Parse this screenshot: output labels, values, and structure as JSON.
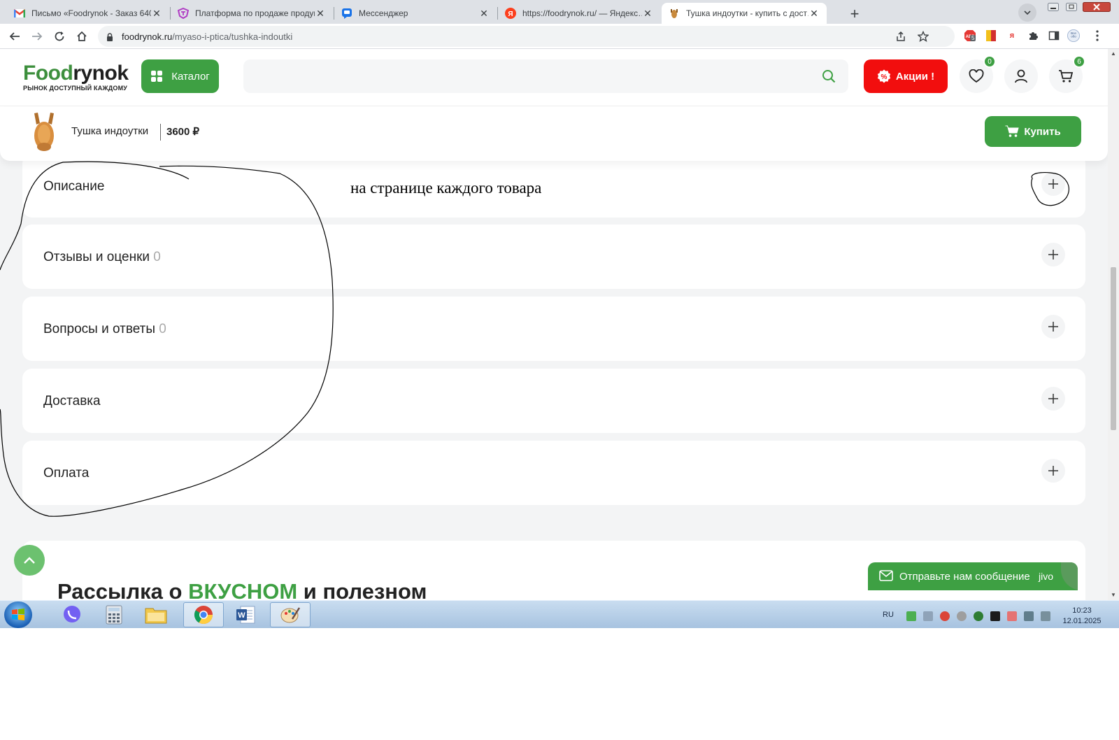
{
  "browser": {
    "tabs": [
      {
        "title": "Письмо «Foodrynok - Заказ 640…",
        "icon": "gmail-icon"
      },
      {
        "title": "Платформа по продаже продук…",
        "icon": "platform-icon"
      },
      {
        "title": "Мессенджер",
        "icon": "messenger-icon"
      },
      {
        "title": "https://foodrynok.ru/ — Яндекс…",
        "icon": "yandex-icon"
      },
      {
        "title": "Тушка индоутки - купить с дост…",
        "icon": "duck-icon"
      }
    ],
    "address": {
      "domain": "foodrynok.ru",
      "path": "/myaso-i-ptica/tushka-indoutki"
    },
    "extension_badge": "5"
  },
  "site": {
    "logo": {
      "part1": "Food",
      "part2": "rynok",
      "tagline": "РЫНОК ДОСТУПНЫЙ КАЖДОМУ"
    },
    "catalog_label": "Каталог",
    "promo_label": "Акции !",
    "favorites_count": "0",
    "cart_count": "6"
  },
  "product": {
    "name": "Тушка индоутки",
    "price": "3600 ₽",
    "buy_label": "Купить"
  },
  "sections": [
    {
      "title": "Описание",
      "count": ""
    },
    {
      "title": "Отзывы и оценки",
      "count": "0"
    },
    {
      "title": "Вопросы и ответы",
      "count": "0"
    },
    {
      "title": "Доставка",
      "count": ""
    },
    {
      "title": "Оплата",
      "count": ""
    }
  ],
  "annotation_text": "на странице каждого товара",
  "newsletter": {
    "title_a": "Рассылка о ",
    "title_b": "ВКУСНОМ",
    "title_c": " и полезном"
  },
  "chat": {
    "label": "Отправьте нам сообщение",
    "brand": "jivo"
  },
  "taskbar": {
    "lang": "RU",
    "time": "10:23",
    "date": "12.01.2025"
  },
  "colors": {
    "brand_green": "#3ea043",
    "promo_red": "#f20e0e",
    "page_bg": "#f3f4f5"
  }
}
